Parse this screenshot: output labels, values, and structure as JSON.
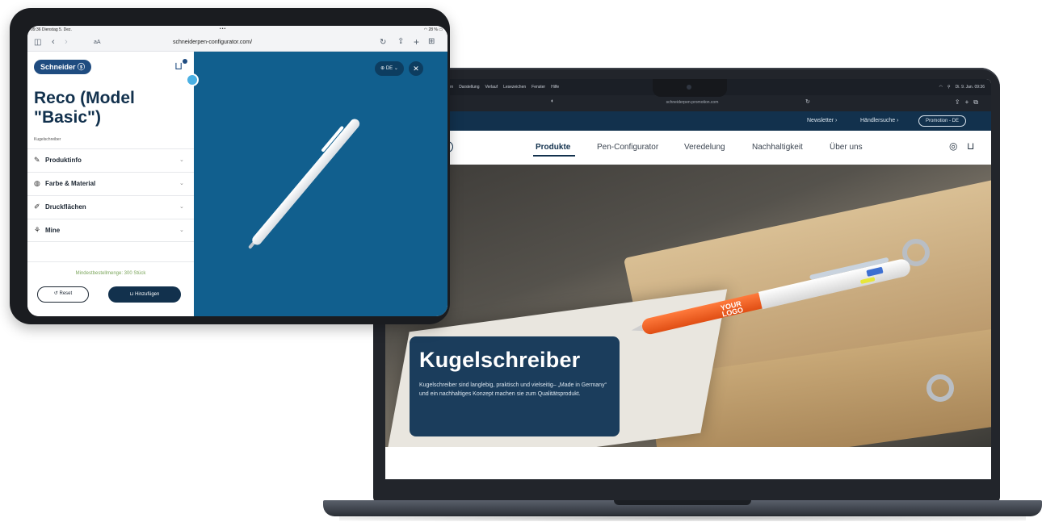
{
  "laptop": {
    "menubar": {
      "items": [
        "Bearbeiten",
        "Darstellung",
        "Verlauf",
        "Lesezeichen",
        "Fenster",
        "Hilfe"
      ],
      "clock": "Di. 9. Jan. 09:36"
    },
    "browser": {
      "url": "schneiderpen-promotion.com"
    },
    "topbar": {
      "newsletter": "Newsletter",
      "dealer": "Händlersuche",
      "promotion": "Promotion - DE"
    },
    "nav": {
      "items": [
        "Produkte",
        "Pen-Configurator",
        "Veredelung",
        "Nachhaltigkeit",
        "Über uns"
      ],
      "active": "Produkte"
    },
    "hero": {
      "title": "Kugelschreiber",
      "text": "Kugelschreiber sind langlebig, praktisch und vielseitig– „Made in Germany“ und ein nachhaltiges Konzept machen sie zum Qualitätsprodukt.",
      "pen_logo_line1": "YOUR",
      "pen_logo_line2": "LOGO"
    }
  },
  "tablet": {
    "status": {
      "time_date": "09:36 Dienstag 5. Dez.",
      "battery": "28 %"
    },
    "browser": {
      "aa": "aA",
      "url": "schneiderpen-configurator.com/"
    },
    "sidebar": {
      "logo": "Schneider",
      "title": "Reco (Model \"Basic\")",
      "subtitle": "Kugelschreiber",
      "sections": [
        {
          "label": "Produktinfo",
          "icon": "pen-icon"
        },
        {
          "label": "Farbe & Material",
          "icon": "palette-icon"
        },
        {
          "label": "Druckflächen",
          "icon": "print-area-icon"
        },
        {
          "label": "Mine",
          "icon": "refill-icon"
        }
      ],
      "minimum": "Mindestbestellmenge: 300 Stück",
      "reset": "Reset",
      "add": "Hinzufügen"
    },
    "canvas": {
      "language": "DE",
      "background": "#115f8e"
    }
  },
  "colors": {
    "brand_dark_blue": "#12314d",
    "hero_card": "#1b3d5c",
    "canvas_blue": "#115f8e",
    "minimum_text": "#7aa55a"
  }
}
